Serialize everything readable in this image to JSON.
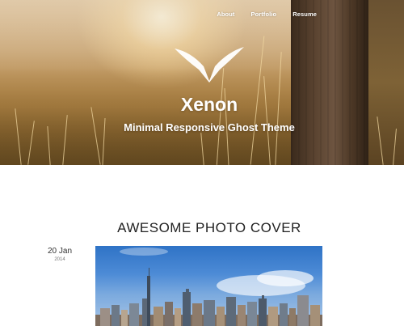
{
  "nav": {
    "items": [
      "About",
      "Portfolio",
      "Resume"
    ]
  },
  "site": {
    "title": "Xenon",
    "description": "Minimal Responsive Ghost Theme"
  },
  "post": {
    "title": "AWESOME PHOTO COVER",
    "date_day": "20 Jan",
    "date_year": "2014"
  },
  "icons": {
    "logo": "bird-wings-logo-icon"
  },
  "colors": {
    "text_dark": "#222222",
    "hero_gold": "#c9a574",
    "sky_blue": "#4d8bd6"
  }
}
